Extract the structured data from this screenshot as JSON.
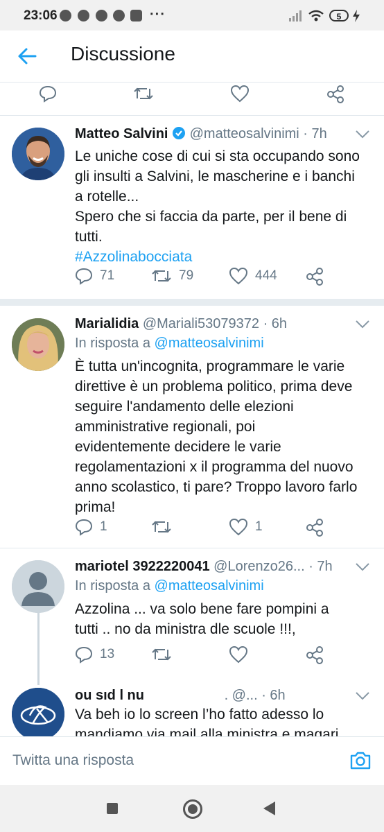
{
  "status_bar": {
    "time": "23:06",
    "battery": "5"
  },
  "header": {
    "title": "Discussione"
  },
  "tweets": [
    {
      "name": "Matteo Salvini",
      "handle": "@matteosalvinimi",
      "time": "· 7h",
      "text_lines": [
        "Le uniche cose di cui si sta occupando sono",
        "gli insulti a Salvini, le mascherine e i banchi",
        "a rotelle...",
        "Spero che si faccia da parte, per il bene di",
        "tutti."
      ],
      "hashtag": "#Azzolinabocciata",
      "replies": "71",
      "retweets": "79",
      "likes": "444"
    },
    {
      "name": "Marialidia",
      "handle": "@Mariali53079372",
      "time": "· 6h",
      "reply_prefix": "In risposta a",
      "reply_to": "@matteosalvinimi",
      "text_lines": [
        "È tutta un'incognita, programmare le varie",
        "direttive è un problema politico, prima deve",
        "seguire l'andamento delle elezioni",
        "amministrative regionali, poi",
        "evidentemente decidere le varie",
        "regolamentazioni x il programma del nuovo",
        "anno scolastico, ti pare? Troppo lavoro farlo",
        "prima!"
      ],
      "replies": "1",
      "retweets": "",
      "likes": "1"
    },
    {
      "name": "mariotel 3922220041",
      "handle": "@Lorenzo26...",
      "time": "· 7h",
      "reply_prefix": "In risposta a",
      "reply_to": "@matteosalvinimi",
      "text_lines": [
        "Azzolina ... va solo bene fare pompini a",
        "tutti .. no da ministra dle scuole !!!,"
      ],
      "replies": "13",
      "retweets": "",
      "likes": ""
    },
    {
      "name": "ou   sıd   l    nu",
      "handle": ". @...",
      "time": "· 6h",
      "text_lines": [
        "Va beh io lo screen l’ho fatto adesso lo",
        "mandiamo via mail alla ministra e magari"
      ]
    }
  ],
  "compose": {
    "placeholder": "Twitta una risposta"
  },
  "colors": {
    "accent": "#1da1f2",
    "muted": "#657786",
    "text": "#14171a",
    "separator": "#e6ecf0"
  }
}
